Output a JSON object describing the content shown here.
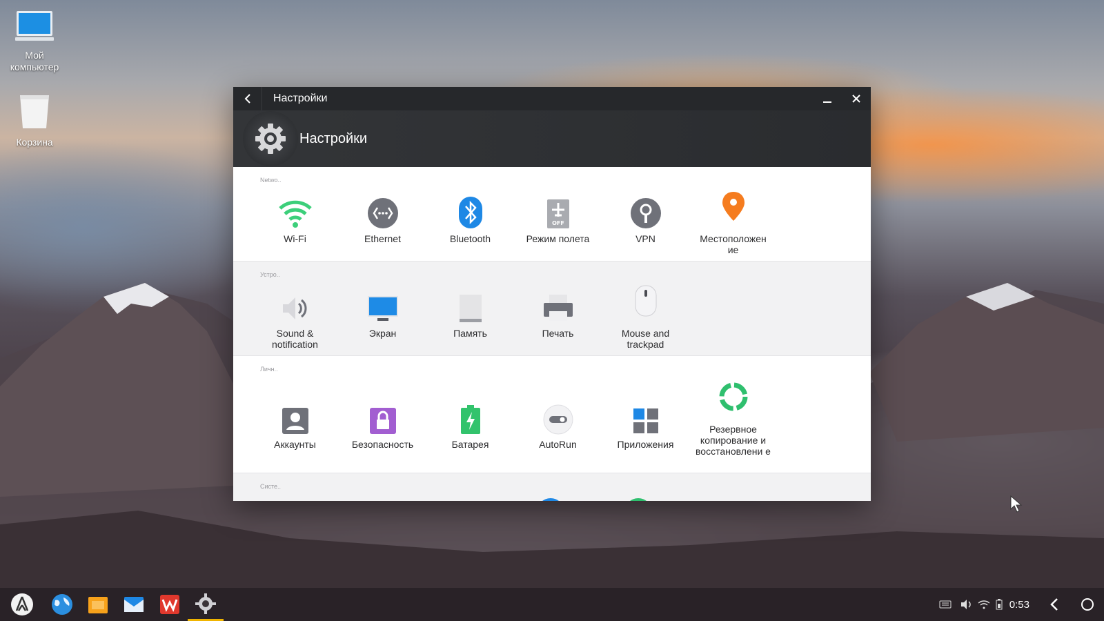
{
  "desktop": {
    "icons": [
      {
        "label": "Мой компьютер"
      },
      {
        "label": "Корзина"
      }
    ]
  },
  "window": {
    "titlebar_title": "Настройки",
    "header_title": "Настройки",
    "sections": [
      {
        "label": "Netwo..",
        "items": [
          {
            "label": "Wi-Fi",
            "icon": "wifi-icon"
          },
          {
            "label": "Ethernet",
            "icon": "ethernet-icon"
          },
          {
            "label": "Bluetooth",
            "icon": "bluetooth-icon"
          },
          {
            "label": "Режим полета",
            "icon": "airplane-mode-icon"
          },
          {
            "label": "VPN",
            "icon": "vpn-key-icon"
          },
          {
            "label": "Местоположен ие",
            "icon": "location-pin-icon"
          }
        ]
      },
      {
        "label": "Устро..",
        "items": [
          {
            "label": "Sound & notification",
            "icon": "speaker-icon"
          },
          {
            "label": "Экран",
            "icon": "monitor-icon"
          },
          {
            "label": "Память",
            "icon": "storage-icon"
          },
          {
            "label": "Печать",
            "icon": "printer-icon"
          },
          {
            "label": "Mouse and trackpad",
            "icon": "mouse-icon"
          }
        ]
      },
      {
        "label": "Личн..",
        "items": [
          {
            "label": "Аккаунты",
            "icon": "account-icon"
          },
          {
            "label": "Безопасность",
            "icon": "lock-icon"
          },
          {
            "label": "Батарея",
            "icon": "battery-icon"
          },
          {
            "label": "AutoRun",
            "icon": "toggle-icon"
          },
          {
            "label": "Приложения",
            "icon": "apps-grid-icon"
          },
          {
            "label": "Резервное копирование и восстановлени е",
            "icon": "backup-restore-icon"
          }
        ]
      },
      {
        "label": "Систе..",
        "items": []
      }
    ]
  },
  "taskbar": {
    "clock": "0:53",
    "apps": [
      "start-menu-icon",
      "browser-globe-icon",
      "file-manager-icon",
      "mail-icon",
      "wps-office-icon",
      "settings-gear-icon"
    ]
  }
}
